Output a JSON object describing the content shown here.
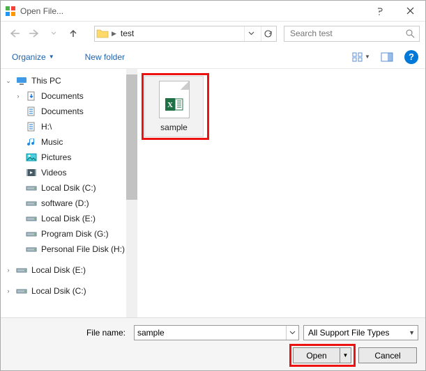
{
  "window": {
    "title": "Open File..."
  },
  "nav": {
    "crumb_current": "test"
  },
  "search": {
    "placeholder": "Search test"
  },
  "toolbar": {
    "organize": "Organize",
    "new_folder": "New folder"
  },
  "sidebar": {
    "this_pc": "This PC",
    "items": [
      {
        "label": "Documents",
        "icon": "documents-down"
      },
      {
        "label": "Documents",
        "icon": "documents"
      },
      {
        "label": "H:\\",
        "icon": "documents"
      },
      {
        "label": "Music",
        "icon": "music"
      },
      {
        "label": "Pictures",
        "icon": "pictures"
      },
      {
        "label": "Videos",
        "icon": "videos"
      },
      {
        "label": "Local Dsik (C:)",
        "icon": "drive"
      },
      {
        "label": "software (D:)",
        "icon": "drive"
      },
      {
        "label": "Local Disk (E:)",
        "icon": "drive"
      },
      {
        "label": "Program Disk  (G:)",
        "icon": "drive"
      },
      {
        "label": "Personal File Disk (H:)",
        "icon": "drive"
      }
    ],
    "extra": [
      {
        "label": "Local Disk (E:)",
        "icon": "drive"
      },
      {
        "label": "Local Dsik (C:)",
        "icon": "drive"
      }
    ]
  },
  "main": {
    "files": [
      {
        "name": "sample"
      }
    ]
  },
  "footer": {
    "filename_label": "File name:",
    "filename_value": "sample",
    "filter_label": "All Support File Types",
    "open": "Open",
    "cancel": "Cancel"
  }
}
